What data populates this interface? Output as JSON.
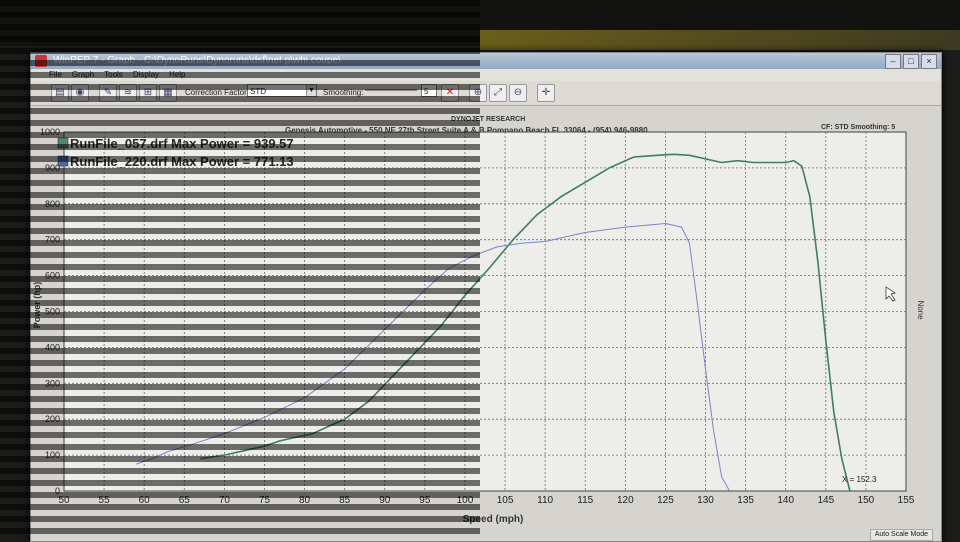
{
  "window": {
    "title": "WinPEP 7 - Graph - C:\\DynoRuns\\Dynoruns\\dsf\\net p\\whi coupe\\",
    "menus": [
      "File",
      "Graph",
      "Tools",
      "Display",
      "Help"
    ]
  },
  "toolbar": {
    "correction_factor_label": "Correction Factor:",
    "correction_factor_value": "STD",
    "smoothing_label": "Smoothing:",
    "smoothing_value": "5"
  },
  "header": {
    "brand": "DYNOJET RESEARCH",
    "shop": "Genesis Automotive - 550 NE 27th Street Suite A & B Pompano Beach FL 33064 - (954) 946-9880",
    "right_info": "CF: STD  Smoothing: 5"
  },
  "legend": [
    {
      "text": "RunFile_057.drf Max Power = 939.57",
      "color": "#4f8a6b"
    },
    {
      "text": "RunFile_220.drf Max Power = 771.13",
      "color": "#5566aa"
    }
  ],
  "colors": {
    "run057": "#3f7f5c",
    "run220": "#7a86c8",
    "grid": "#6a6a6a",
    "plot_bg": "#ededea"
  },
  "status": {
    "mode": "Auto Scale Mode",
    "cursor_readout": "X = 152.3"
  },
  "right_axis_label": "None",
  "chart_data": {
    "type": "line",
    "xlabel": "Speed (mph)",
    "ylabel": "Power (hp)",
    "xlim": [
      50,
      155
    ],
    "ylim": [
      0,
      1000
    ],
    "x_ticks": [
      50,
      55,
      60,
      65,
      70,
      75,
      80,
      85,
      90,
      95,
      100,
      105,
      110,
      115,
      120,
      125,
      130,
      135,
      140,
      145,
      150,
      155
    ],
    "y_ticks": [
      0,
      100,
      200,
      300,
      400,
      500,
      600,
      700,
      800,
      900,
      1000
    ],
    "grid": true,
    "legend_position": "top-left",
    "series": [
      {
        "name": "RunFile_057.drf",
        "x": [
          67,
          70,
          73,
          75,
          77,
          79,
          81,
          83,
          85,
          88,
          91,
          94,
          97,
          100,
          103,
          106,
          109,
          112,
          115,
          118,
          121,
          124,
          126,
          128,
          130,
          132,
          134,
          136,
          138,
          140,
          141,
          142,
          143,
          144,
          145,
          146,
          147,
          148
        ],
        "y": [
          90,
          100,
          115,
          125,
          140,
          150,
          160,
          180,
          200,
          250,
          320,
          390,
          460,
          545,
          620,
          700,
          770,
          820,
          860,
          900,
          930,
          935,
          938,
          935,
          925,
          915,
          920,
          915,
          915,
          915,
          920,
          905,
          820,
          640,
          420,
          220,
          90,
          0
        ]
      },
      {
        "name": "RunFile_220.drf",
        "x": [
          59,
          61,
          63,
          66,
          70,
          75,
          80,
          85,
          90,
          95,
          98,
          101,
          104,
          107,
          110,
          115,
          120,
          125,
          127,
          128,
          129,
          130,
          131,
          132,
          133
        ],
        "y": [
          75,
          90,
          110,
          130,
          160,
          205,
          260,
          340,
          450,
          560,
          620,
          655,
          680,
          690,
          695,
          720,
          735,
          745,
          735,
          690,
          520,
          340,
          170,
          40,
          0
        ]
      }
    ]
  }
}
